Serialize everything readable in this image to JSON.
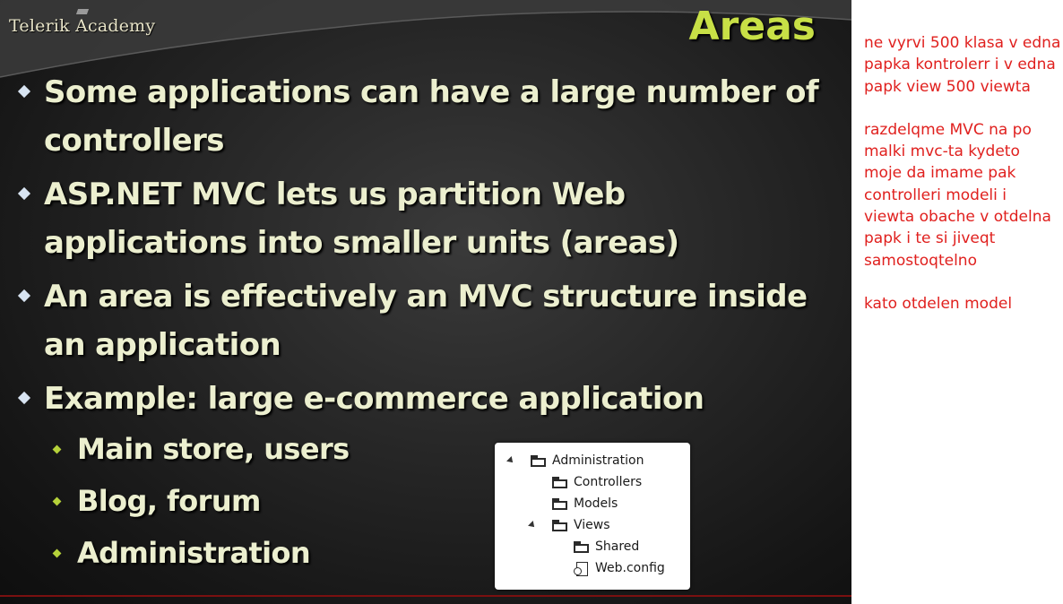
{
  "slide": {
    "logo": "Telerik Academy",
    "title": "Areas",
    "bullets": [
      {
        "text": "Some applications can have a large number of controllers"
      },
      {
        "text": "ASP.NET MVC lets us partition Web applications into smaller units (areas)"
      },
      {
        "text": "An area is effectively an MVC structure inside an application"
      },
      {
        "text": "Example: large e-commerce application",
        "subitems": [
          "Main store, users",
          "Blog, forum",
          "Administration"
        ]
      }
    ],
    "tree": {
      "root": "Administration",
      "children": [
        "Controllers",
        "Models",
        "Views"
      ],
      "views_children": [
        "Shared",
        "Web.config"
      ]
    }
  },
  "notes": [
    "ne vyrvi 500 klasa v edna papka kontrolerr i v edna papk view 500 viewta",
    "razdelqme MVC na po malki mvc-ta kydeto moje da imame pak controlleri modeli i viewta obache v otdelna papk i te si jiveqt samostoqtelno",
    "kato otdelen model"
  ],
  "colors": {
    "title": "#c8e046",
    "bullet_text": "#ecefcf",
    "notes_text": "#e0201e",
    "slide_bg": "#252525"
  }
}
